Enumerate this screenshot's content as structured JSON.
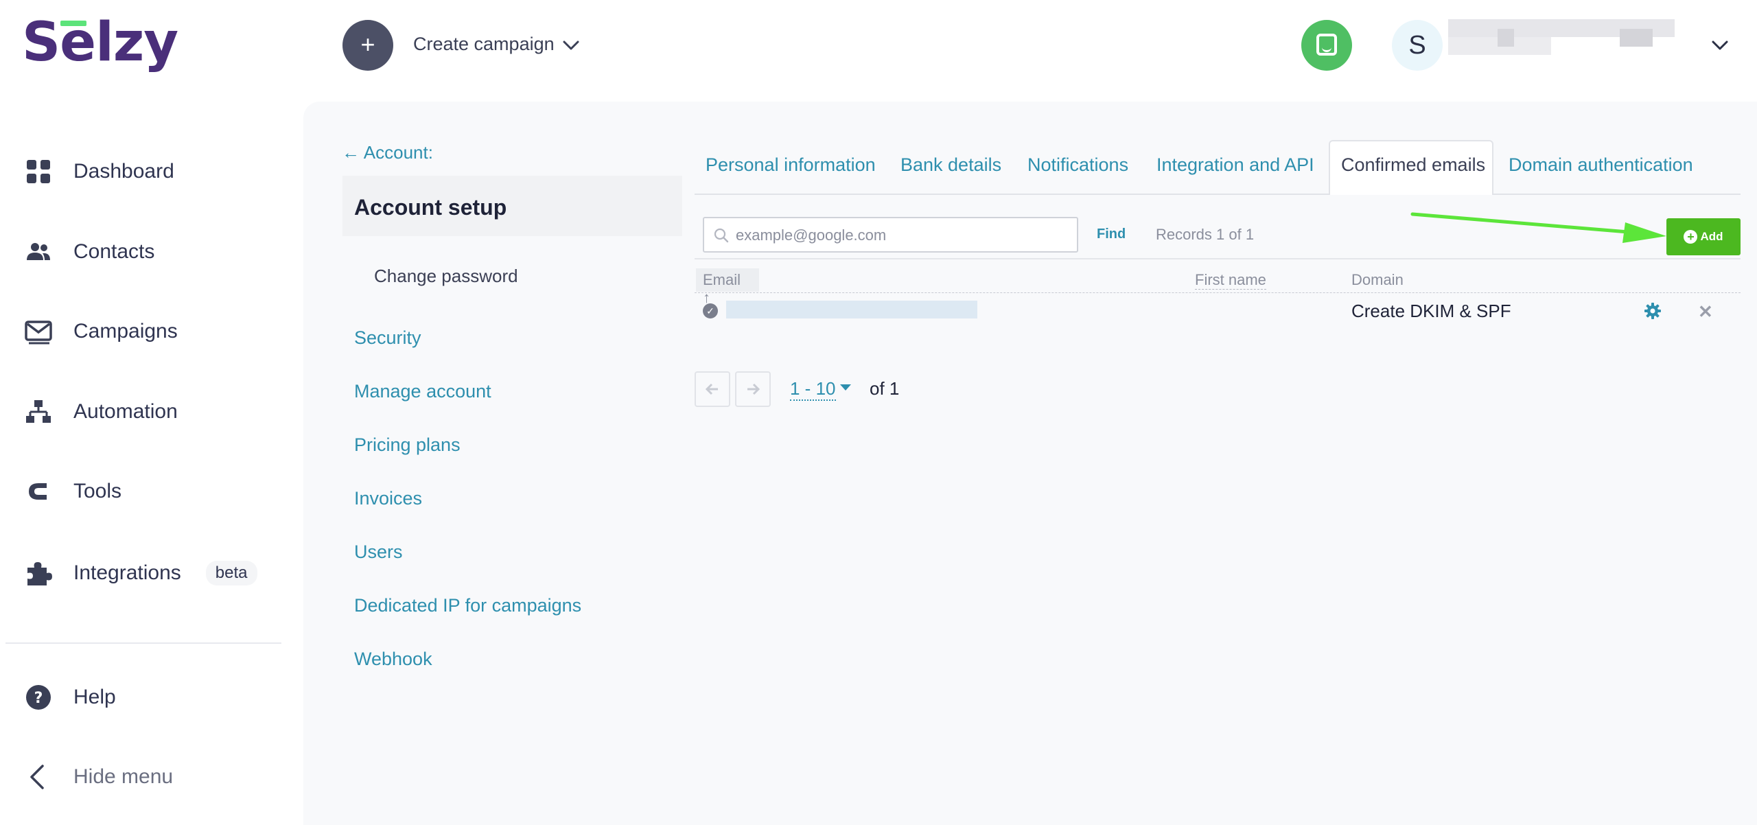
{
  "header": {
    "logo": "Selzy",
    "create_label": "Create campaign",
    "avatar_letter": "S"
  },
  "sidebar": {
    "items": [
      {
        "label": "Dashboard",
        "icon": "grid-icon"
      },
      {
        "label": "Contacts",
        "icon": "people-icon"
      },
      {
        "label": "Campaigns",
        "icon": "envelope-icon"
      },
      {
        "label": "Automation",
        "icon": "flowchart-icon"
      },
      {
        "label": "Tools",
        "icon": "magnet-icon"
      },
      {
        "label": "Integrations",
        "icon": "puzzle-icon",
        "badge": "beta"
      }
    ],
    "help": "Help",
    "hide_menu": "Hide menu"
  },
  "account": {
    "back_link": "← Account:",
    "setup_title": "Account setup",
    "change_password": "Change password",
    "menu": [
      "Security",
      "Manage account",
      "Pricing plans",
      "Invoices",
      "Users",
      "Dedicated IP for campaigns",
      "Webhook"
    ]
  },
  "tabs": {
    "items": [
      "Personal information",
      "Bank details",
      "Notifications",
      "Integration and API",
      "Confirmed emails",
      "Domain authentication"
    ],
    "active": "Confirmed emails"
  },
  "toolbar": {
    "search_placeholder": "example@google.com",
    "find_label": "Find",
    "records": "Records 1 of 1",
    "add_label": "Add"
  },
  "table": {
    "columns": {
      "email": "Email ↑",
      "first_name": "First name",
      "domain": "Domain"
    },
    "rows": [
      {
        "domain": "Create DKIM & SPF"
      }
    ]
  },
  "pagination": {
    "range": "1 - 10",
    "of": "of 1"
  },
  "colors": {
    "brand": "#4a2f7a",
    "accent_link": "#2e8fae",
    "add_button": "#4cb820",
    "chat_button": "#4fbf63",
    "annotation_arrow": "#5ce53a"
  }
}
